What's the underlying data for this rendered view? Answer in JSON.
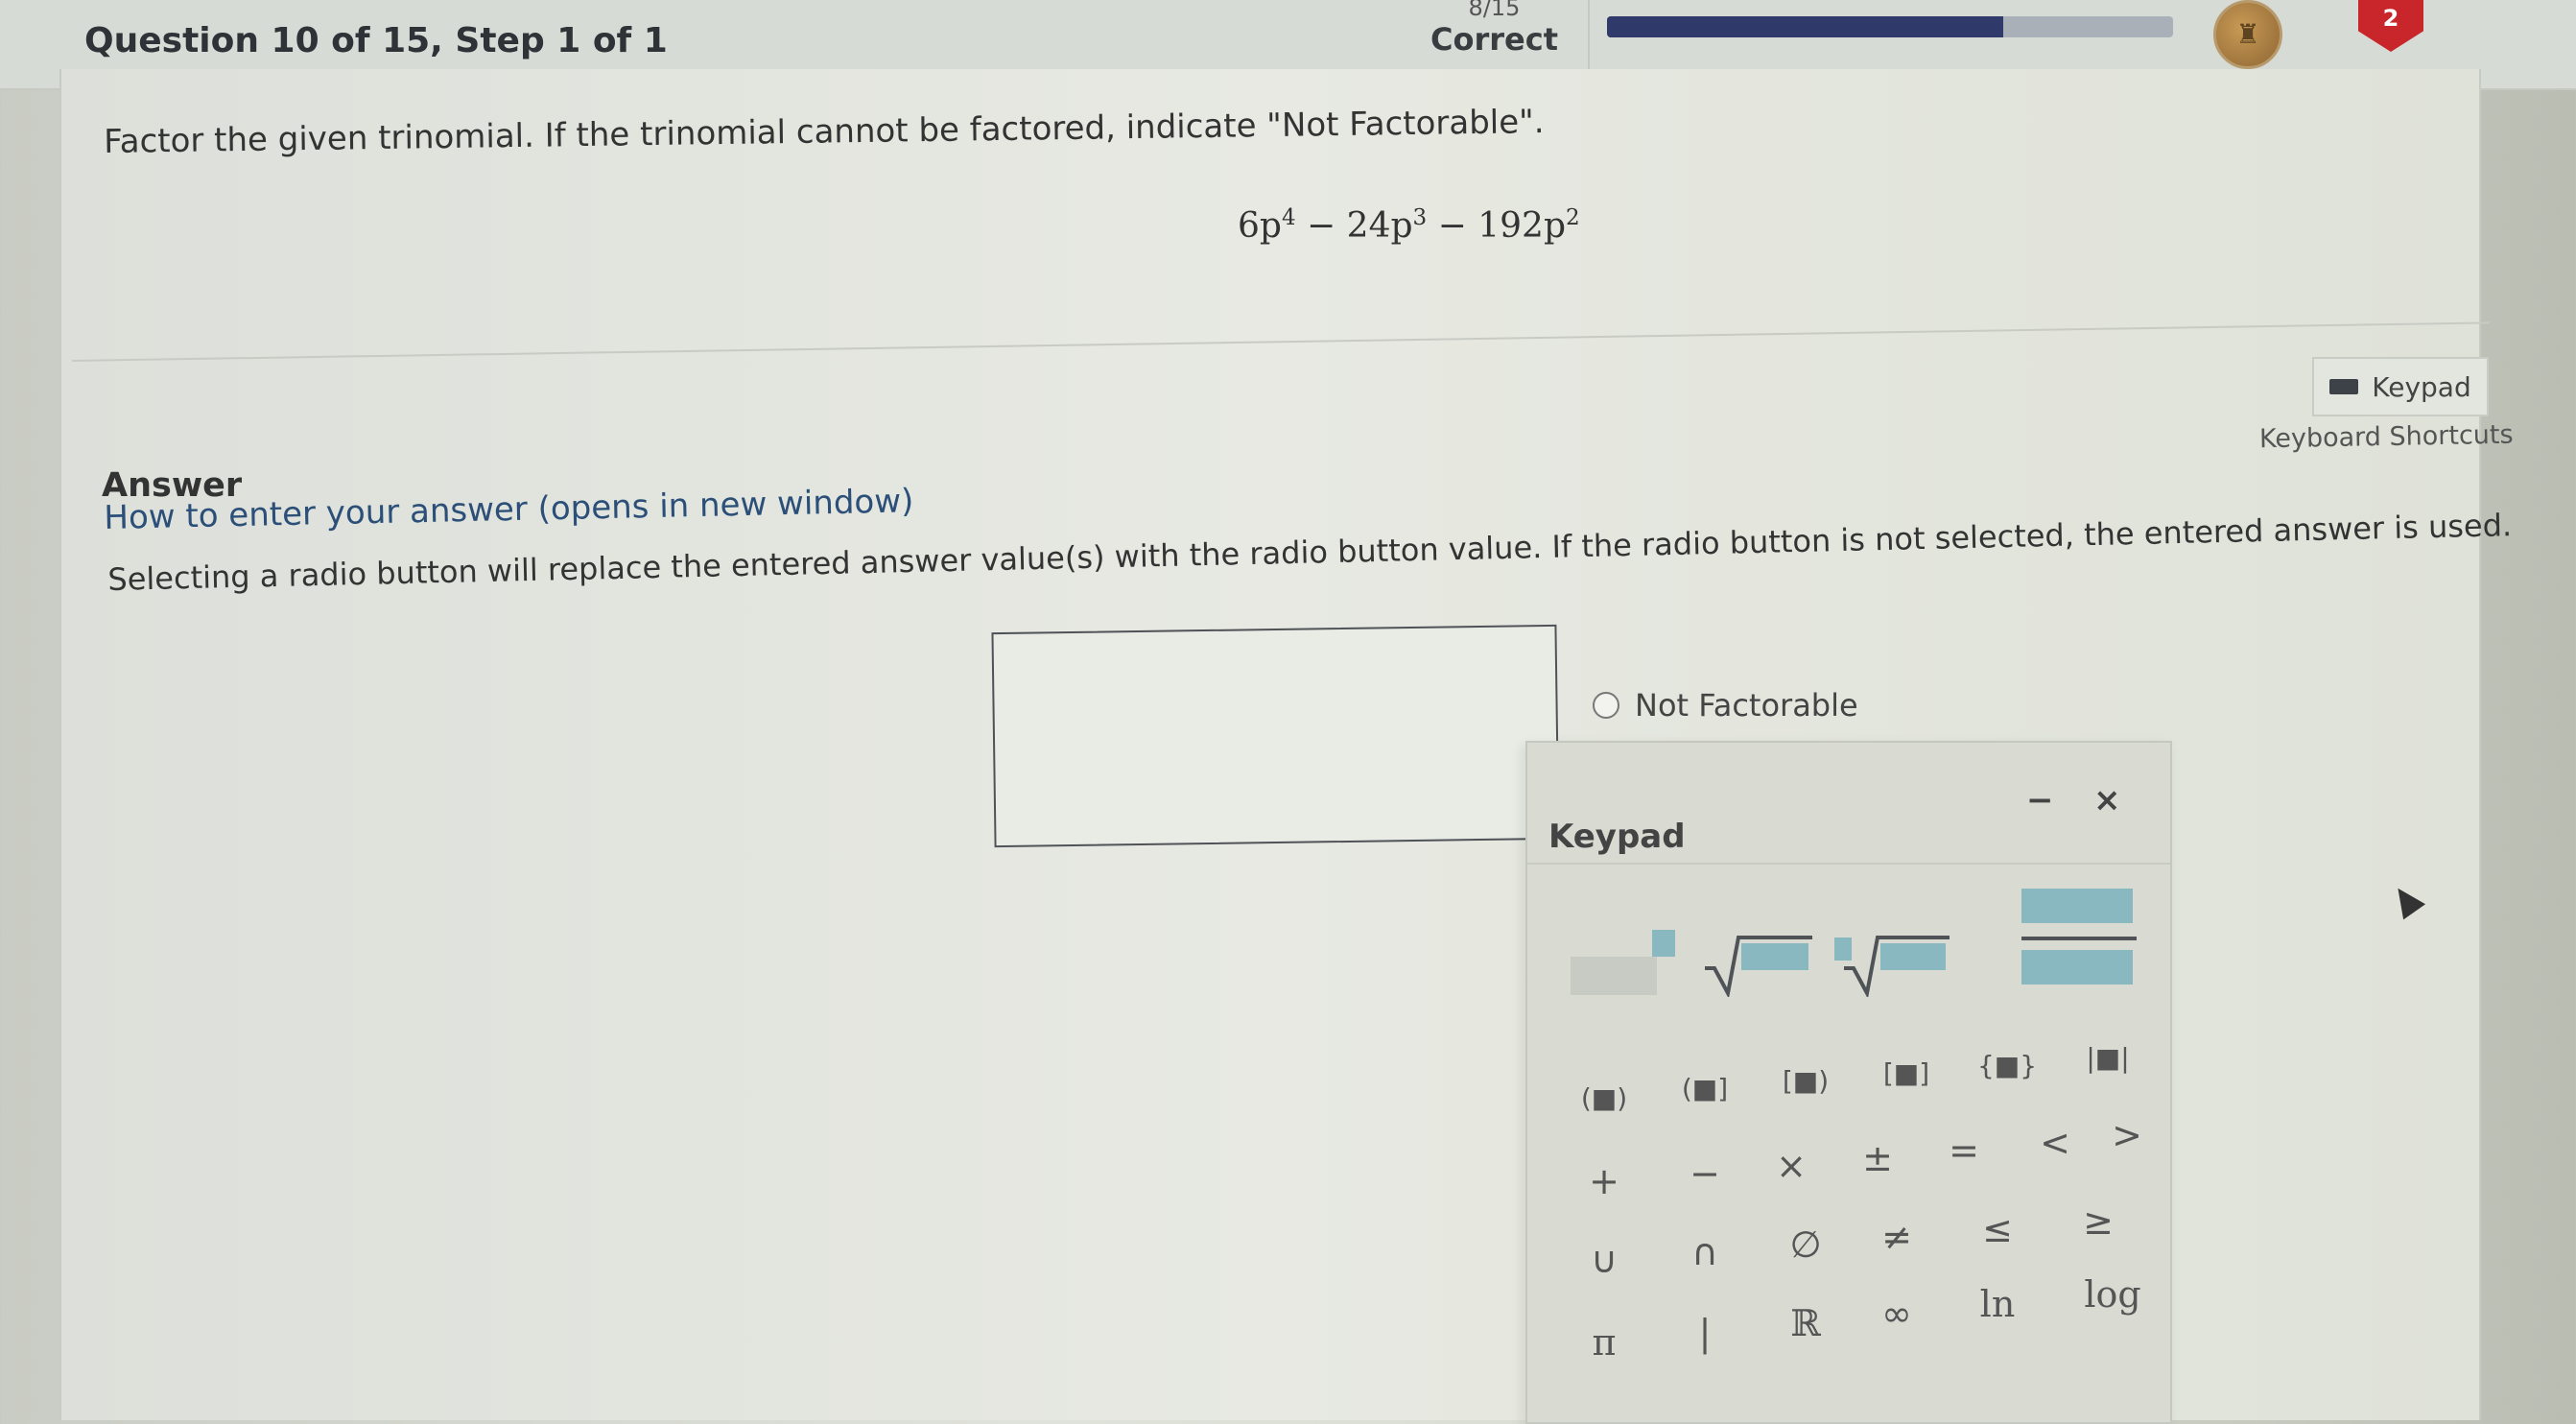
{
  "header": {
    "question_title": "Question 10 of 15, Step 1 of 1",
    "score": "8/15",
    "correct_label": "Correct",
    "progress_percent": 70,
    "alert_count": "2"
  },
  "question": {
    "prompt": "Factor the given trinomial. If the trinomial cannot be factored, indicate \"Not Factorable\".",
    "expression": {
      "t1_coef": "6p",
      "t1_exp": "4",
      "op1": "−",
      "t2_coef": "24p",
      "t2_exp": "3",
      "op2": "−",
      "t3_coef": "192p",
      "t3_exp": "2"
    }
  },
  "tools": {
    "keypad_button": "Keypad",
    "keyboard_shortcuts": "Keyboard Shortcuts"
  },
  "answer": {
    "heading": "Answer",
    "how_to": "How to enter your answer (opens in new window)",
    "instruction": "Selecting a radio button will replace the entered answer value(s) with the radio button value. If the radio button is not selected, the entered answer is used.",
    "radio_label": "Not Factorable",
    "input_value": ""
  },
  "keypad": {
    "title": "Keypad",
    "minimize": "−",
    "close": "×",
    "rows": [
      [
        "(■)",
        "(■]",
        "[■)",
        "[■]",
        "{■}",
        "|■|"
      ],
      [
        "+",
        "−",
        "×",
        "±",
        "=",
        "<",
        ">"
      ],
      [
        "∪",
        "∩",
        "∅",
        "≠",
        "≤",
        "≥"
      ],
      [
        "π",
        "|",
        "ℝ",
        "∞",
        "ln",
        "log"
      ]
    ]
  },
  "colors": {
    "progress_fill": "#2f3a6a",
    "alert_badge": "#c8262b",
    "link": "#2b4f78",
    "template_highlight": "#8ab8c0"
  }
}
